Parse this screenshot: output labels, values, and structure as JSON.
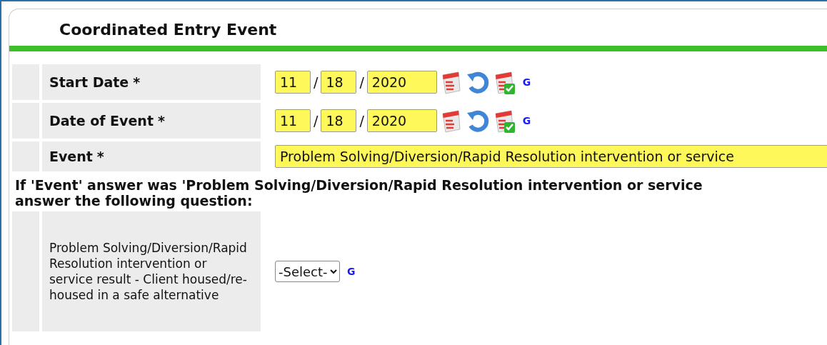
{
  "panel": {
    "title": "Coordinated Entry Event"
  },
  "date_rows": [
    {
      "label": "Start Date",
      "required_mark": "*",
      "month": "11",
      "day": "18",
      "year": "2020",
      "separator": "/",
      "g_link": "G"
    },
    {
      "label": "Date of Event",
      "required_mark": "*",
      "month": "11",
      "day": "18",
      "year": "2020",
      "separator": "/",
      "g_link": "G"
    }
  ],
  "event_row": {
    "label": "Event",
    "required_mark": "*",
    "value": "Problem Solving/Diversion/Rapid Resolution intervention or service"
  },
  "note": [
    "If 'Event' answer was 'Problem Solving/Diversion/Rapid Resolution intervention or service",
    "answer the following question:"
  ],
  "question_row": {
    "label": "Problem Solving/Diversion/Rapid Resolution intervention or service result - Client housed/re-housed in a safe alternative",
    "select": "-Select-",
    "g_link": "G"
  }
}
